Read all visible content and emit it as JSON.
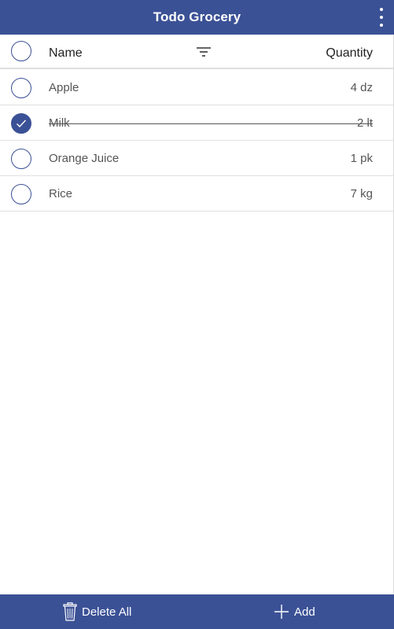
{
  "header": {
    "title": "Todo Grocery",
    "menu_icon": "more-vertical-icon"
  },
  "columns": {
    "name": "Name",
    "quantity": "Quantity",
    "filter_icon": "filter-icon"
  },
  "items": [
    {
      "name": "Apple",
      "quantity": "4 dz",
      "done": false
    },
    {
      "name": "Milk",
      "quantity": "2 lt",
      "done": true
    },
    {
      "name": "Orange Juice",
      "quantity": "1 pk",
      "done": false
    },
    {
      "name": "Rice",
      "quantity": "7 kg",
      "done": false
    }
  ],
  "footer": {
    "delete_all": "Delete All",
    "delete_icon": "trash-icon",
    "add": "Add",
    "add_icon": "plus-icon"
  },
  "colors": {
    "primary": "#3b5196",
    "background": "#ffffff",
    "divider": "#e0e0e0"
  }
}
